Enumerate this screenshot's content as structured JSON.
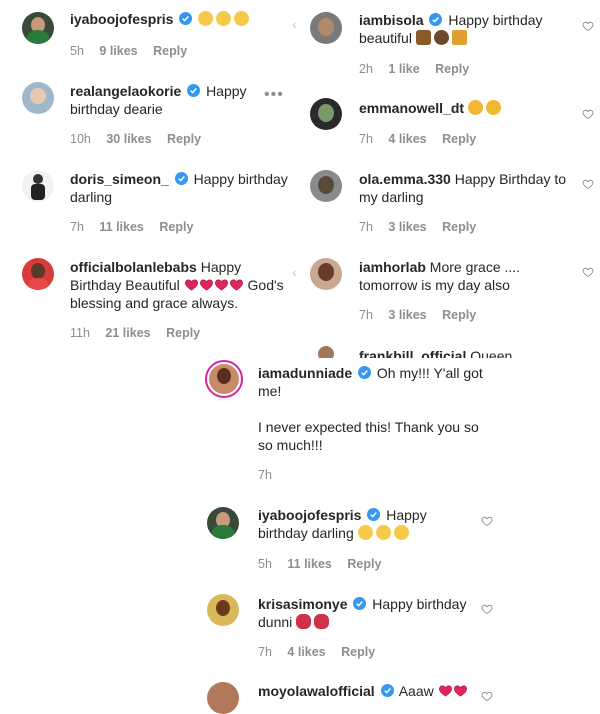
{
  "comments_left": [
    {
      "user": "iyaboojofespris",
      "text": "",
      "emoji": [
        "star-eyes",
        "star-eyes",
        "kiss"
      ],
      "time": "5h",
      "likes": "9 likes",
      "reply": "Reply"
    },
    {
      "user": "realangelaokorie",
      "text": "Happy birthday dearie",
      "emoji": [],
      "time": "10h",
      "likes": "30 likes",
      "reply": "Reply"
    },
    {
      "user": "doris_simeon_",
      "text": "Happy birthday darling",
      "emoji": [],
      "time": "7h",
      "likes": "11 likes",
      "reply": "Reply"
    },
    {
      "user": "officialbolanlebabs",
      "text": "Happy Birthday Beautiful",
      "text2": "God's blessing and grace always.",
      "emoji": [
        "heart",
        "heart",
        "heart",
        "heart"
      ],
      "time": "11h",
      "likes": "21 likes",
      "reply": "Reply"
    }
  ],
  "comments_right": [
    {
      "user": "iambisola",
      "text": "Happy birthday beautiful",
      "emoji": [
        "cake",
        "hands",
        "party"
      ],
      "time": "2h",
      "likes": "1 like",
      "reply": "Reply"
    },
    {
      "user": "emmanowell_dt",
      "text": "",
      "emoji": [
        "clap",
        "clap"
      ],
      "time": "7h",
      "likes": "4 likes",
      "reply": "Reply"
    },
    {
      "user": "ola.emma.330",
      "text": "Happy Birthday to my darling",
      "emoji": [],
      "time": "7h",
      "likes": "3 likes",
      "reply": "Reply"
    },
    {
      "user": "iamhorlab",
      "text": "More grace .... tomorrow is my day also",
      "emoji": [],
      "time": "7h",
      "likes": "3 likes",
      "reply": "Reply"
    },
    {
      "user": "frankbill_official",
      "text": "Queen",
      "emoji": []
    }
  ],
  "main_comment": {
    "user": "iamadunniade",
    "text1": "Oh my!!! Y'all got me!",
    "text2": "I never expected this! Thank you so so much!!!",
    "time": "7h"
  },
  "replies": [
    {
      "user": "iyaboojofespris",
      "text": "Happy birthday darling",
      "emoji": [
        "star-eyes",
        "star-eyes",
        "kiss"
      ],
      "time": "5h",
      "likes": "11 likes",
      "reply": "Reply"
    },
    {
      "user": "krisasimonye",
      "text": "Happy birthday dunni",
      "emoji": [
        "lips",
        "lips"
      ],
      "time": "7h",
      "likes": "4 likes",
      "reply": "Reply"
    },
    {
      "user": "moyolawalofficial",
      "text": "Aaaw",
      "emoji": [
        "heart",
        "heart"
      ]
    }
  ],
  "colors": {
    "accent": "#3897f0",
    "meta": "#8e8e8e",
    "text": "#262626",
    "heart": "#ed4956"
  }
}
